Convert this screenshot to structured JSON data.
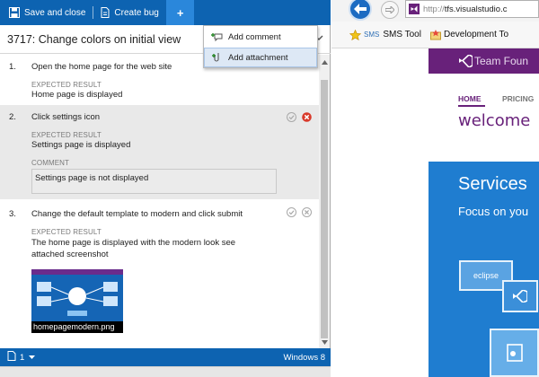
{
  "runner": {
    "toolbar": {
      "save_close_label": "Save and close",
      "create_bug_label": "Create bug",
      "add_menu_label": "+"
    },
    "dropdown": {
      "items": [
        {
          "label": "Add comment",
          "icon": "comment-add-icon"
        },
        {
          "label": "Add attachment",
          "icon": "attachment-icon"
        }
      ]
    },
    "title": "3717: Change colors on initial view",
    "steps": [
      {
        "number": "1.",
        "action": "Open the home page for the web site",
        "expected_label": "EXPECTED RESULT",
        "expected": "Home page is displayed"
      },
      {
        "number": "2.",
        "action": "Click settings icon",
        "expected_label": "EXPECTED RESULT",
        "expected": "Settings page is displayed",
        "comment_label": "COMMENT",
        "comment": "Settings page is not displayed",
        "status": "failed"
      },
      {
        "number": "3.",
        "action": "Change the default template to modern and click submit",
        "expected_label": "EXPECTED RESULT",
        "expected_line1": "The home page is displayed with the modern look see",
        "expected_line2": "attached screenshot",
        "attachment_name": "homepagemodern.png"
      }
    ],
    "status": {
      "count": "1",
      "os": "Windows 8"
    },
    "colors": {
      "toolbar": "#0d63b1",
      "fail": "#d93a2b",
      "selected_row": "#e9e9e9"
    }
  },
  "browser": {
    "url_protocol": "http://",
    "url_host": "tfs.visualstudio.c",
    "favorites": [
      {
        "label": "SMS Tool",
        "prefix": "SMS",
        "icon": "sms-icon"
      },
      {
        "label": "Development To",
        "icon": "star-folder-icon"
      }
    ],
    "site": {
      "brand": "Team Foun",
      "nav_home": "HOME",
      "nav_pricing": "PRICING",
      "welcome": "welcome",
      "hero_title": "Services",
      "hero_subtitle": "Focus on you",
      "tile_label": "eclipse"
    },
    "colors": {
      "brand_purple": "#68217a",
      "hero_blue": "#1f7dd0"
    }
  }
}
